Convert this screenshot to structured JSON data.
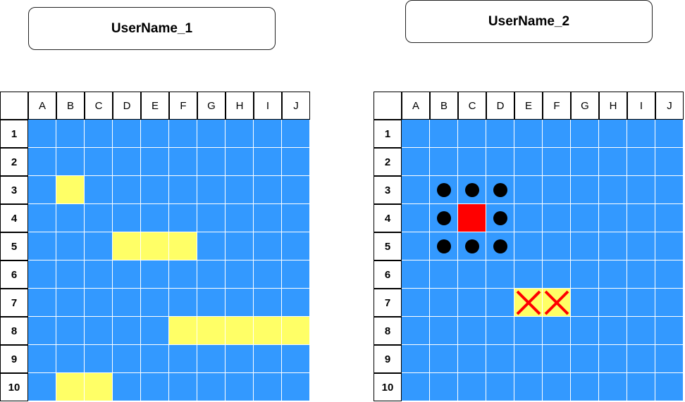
{
  "players": [
    {
      "name": "UserName_1",
      "ships": [
        [
          1,
          2
        ],
        [
          3,
          4
        ],
        [
          4,
          4
        ],
        [
          5,
          4
        ],
        [
          5,
          7
        ],
        [
          6,
          7
        ],
        [
          7,
          7
        ],
        [
          8,
          7
        ],
        [
          9,
          7
        ],
        [
          1,
          9
        ],
        [
          2,
          9
        ]
      ],
      "hits": [],
      "misses": [],
      "sunk": []
    },
    {
      "name": "UserName_2",
      "ships": [],
      "hits": [
        [
          4,
          6
        ],
        [
          5,
          6
        ]
      ],
      "misses": [
        [
          1,
          2
        ],
        [
          2,
          2
        ],
        [
          3,
          2
        ],
        [
          1,
          3
        ],
        [
          3,
          3
        ],
        [
          1,
          4
        ],
        [
          2,
          4
        ],
        [
          3,
          4
        ]
      ],
      "sunk": [
        [
          2,
          3
        ]
      ]
    }
  ],
  "columns": [
    "A",
    "B",
    "C",
    "D",
    "E",
    "F",
    "G",
    "H",
    "I",
    "J"
  ],
  "rows": [
    "1",
    "2",
    "3",
    "4",
    "5",
    "6",
    "7",
    "8",
    "9",
    "10"
  ],
  "colors": {
    "water": "#3399ff",
    "ship": "#ffff66",
    "sunk": "#ff0000",
    "hit_mark": "#ff0000",
    "miss_mark": "#000000"
  },
  "icons": {
    "hit": "cross-icon",
    "miss": "dot-icon"
  }
}
